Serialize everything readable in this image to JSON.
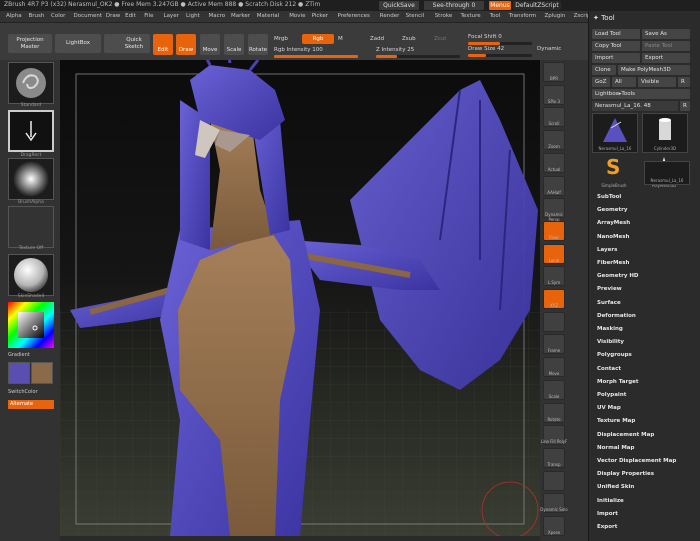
{
  "titlebar": {
    "title": "ZBrush 4R7 P3 (x32)  Nerasmul_OK2  ● Free Mem 3.247GB ● Active Mem 888 ● Scratch Disk 212 ● ZTim",
    "quicksave": "QuickSave",
    "seethrough": "See-through  0",
    "menus": "Menus",
    "defaultscript": "DefaultZScript"
  },
  "menubar": [
    "Alpha",
    "Brush",
    "Color",
    "Document",
    "Draw",
    "Edit",
    "File",
    "Layer",
    "Light",
    "Macro",
    "Marker",
    "Material",
    "Movie",
    "Picker",
    "Preferences",
    "Render",
    "Stencil",
    "Stroke",
    "Texture",
    "Tool",
    "Transform",
    "Zplugin",
    "Zscript"
  ],
  "toolbar": {
    "projection_master": "Projection Master",
    "lightbox": "LightBox",
    "quick_sketch": "Quick Sketch",
    "edit": "Edit",
    "draw": "Draw",
    "move": "Move",
    "scale": "Scale",
    "rotate": "Rotate",
    "mrgb": "Mrgb",
    "rgb": "Rgb",
    "m": "M",
    "zadd": "Zadd",
    "zsub": "Zsub",
    "zcut": "Zcut",
    "rgb_intensity_label": "Rgb Intensity 100",
    "rgb_intensity": 100,
    "z_intensity_label": "Z Intensity 25",
    "z_intensity": 25,
    "focal_shift_label": "Focal Shift 0",
    "focal_shift": 0,
    "draw_size_label": "Draw Size 42",
    "draw_size": 42,
    "dynamic": "Dynamic"
  },
  "leftshelf": {
    "standard": "Standard",
    "dragrect": "DragRect",
    "brushalpha": "BrushAlpha",
    "texture_off": "Texture Off",
    "skinshade": "SkinShade4",
    "gradient": "Gradient",
    "switchcolor": "SwitchColor",
    "alternate": "Alternate",
    "main_color": "#5a4fb0",
    "secondary_color": "#8a6a48"
  },
  "rightshelf": [
    "BPR",
    "SPix 3",
    "Scroll",
    "Zoom",
    "Actual",
    "AAHalf",
    "Dynamic Persp",
    "Floor",
    "Local",
    "L.Sym",
    "XYZ",
    "",
    "Frame",
    "Move",
    "Scale",
    "Rotate",
    "Line Fill PolyF",
    "Transp",
    "",
    "Dynamic Solo",
    "Xpose"
  ],
  "tool": {
    "title": "Tool",
    "load_tool": "Load Tool",
    "save_as": "Save As",
    "copy_tool": "Copy Tool",
    "paste_tool": "Paste Tool",
    "import": "Import",
    "export": "Export",
    "clone": "Clone",
    "make_polymesh": "Make PolyMesh3D",
    "goz": "GoZ",
    "all": "All",
    "visible": "Visible",
    "r": "R",
    "lightbox_tools": "Lightbox▸Tools",
    "current_tool": "Nerasmul_La_16. 48",
    "subtools": [
      "Nerasmul_La_16",
      "Cylinder3D",
      "PolyMesh3D",
      "SimpleBrush",
      "Nerasmul_La_16"
    ],
    "menus": [
      "SubTool",
      "Geometry",
      "ArrayMesh",
      "NanoMesh",
      "Layers",
      "FiberMesh",
      "Geometry HD",
      "Preview",
      "Surface",
      "Deformation",
      "Masking",
      "Visibility",
      "Polygroups",
      "Contact",
      "Morph Target",
      "Polypaint",
      "UV Map",
      "Texture Map",
      "Displacement Map",
      "Normal Map",
      "Vector Displacement Map",
      "Display Properties",
      "Unified Skin",
      "Initialize",
      "Import",
      "Export"
    ]
  }
}
